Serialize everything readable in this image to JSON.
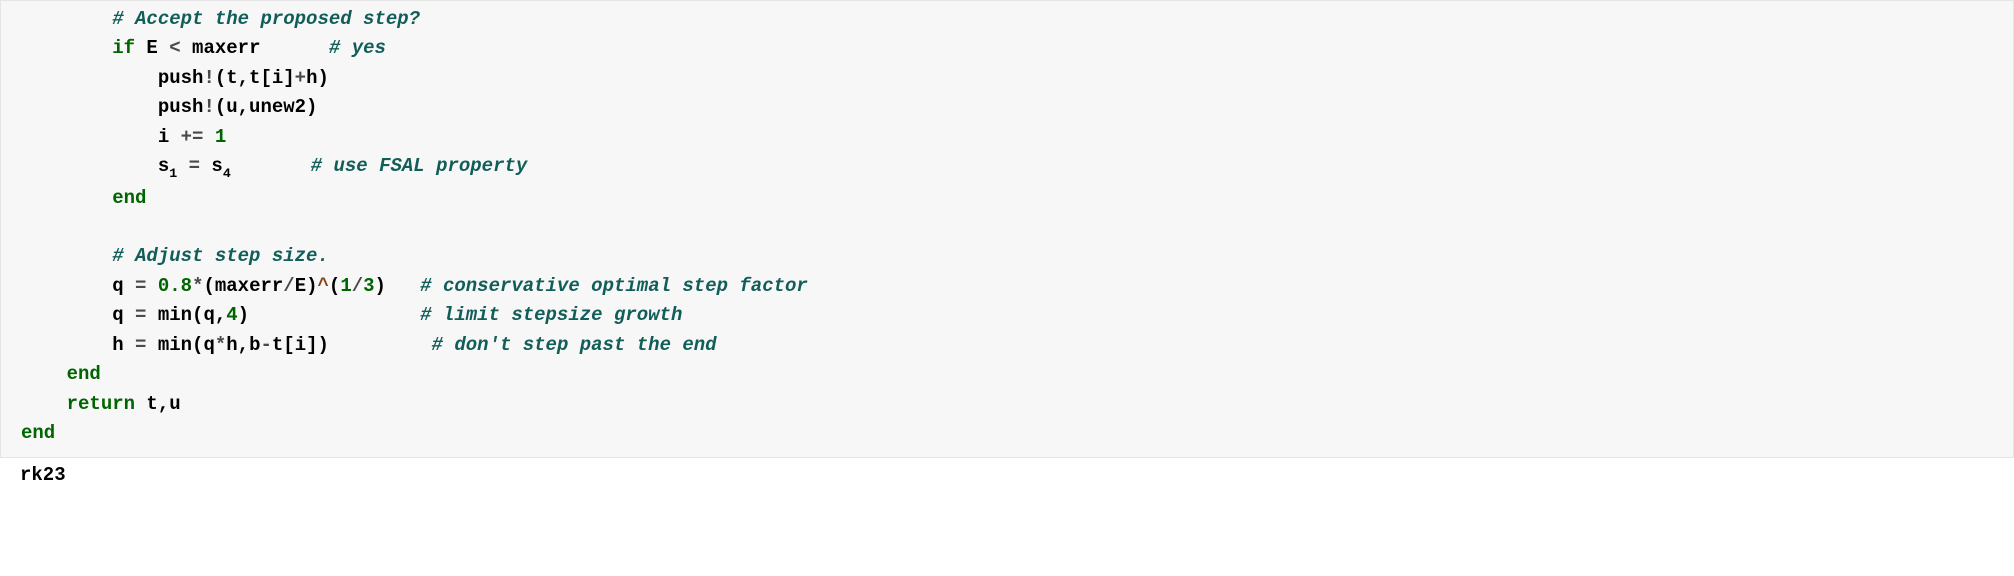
{
  "code": {
    "l1": "        # Accept the proposed step?",
    "l2a": "        ",
    "l2b": "if",
    "l2c": " E ",
    "l2d": "<",
    "l2e": " maxerr      ",
    "l2f": "# yes",
    "l3a": "            push",
    "l3b": "!",
    "l3c": "(t,t[i]",
    "l3d": "+",
    "l3e": "h)",
    "l4a": "            push",
    "l4b": "!",
    "l4c": "(u,unew2)",
    "l5a": "            i ",
    "l5b": "+=",
    "l5c": " ",
    "l5d": "1",
    "l6a": "            s",
    "l6sub1": "1",
    "l6b": " ",
    "l6c": "=",
    "l6d": " s",
    "l6sub4": "4",
    "l6e": "       ",
    "l6f": "# use FSAL property",
    "l7a": "        ",
    "l7b": "end",
    "l8": "",
    "l9a": "        ",
    "l9b": "# Adjust step size.",
    "l10a": "        q ",
    "l10b": "=",
    "l10c": " ",
    "l10d": "0.8",
    "l10e": "*",
    "l10f": "(maxerr",
    "l10g": "/",
    "l10h": "E)",
    "l10i": "^",
    "l10j": "(",
    "l10k": "1",
    "l10l": "/",
    "l10m": "3",
    "l10n": ")   ",
    "l10o": "# conservative optimal step factor",
    "l11a": "        q ",
    "l11b": "=",
    "l11c": " min(q,",
    "l11d": "4",
    "l11e": ")               ",
    "l11f": "# limit stepsize growth",
    "l12a": "        h ",
    "l12b": "=",
    "l12c": " min(q",
    "l12d": "*",
    "l12e": "h,b",
    "l12f": "-",
    "l12g": "t[i])         ",
    "l12h": "# don't step past the end",
    "l13a": "    ",
    "l13b": "end",
    "l14a": "    ",
    "l14b": "return",
    "l14c": " t,u",
    "l15": "end"
  },
  "output": "rk23"
}
